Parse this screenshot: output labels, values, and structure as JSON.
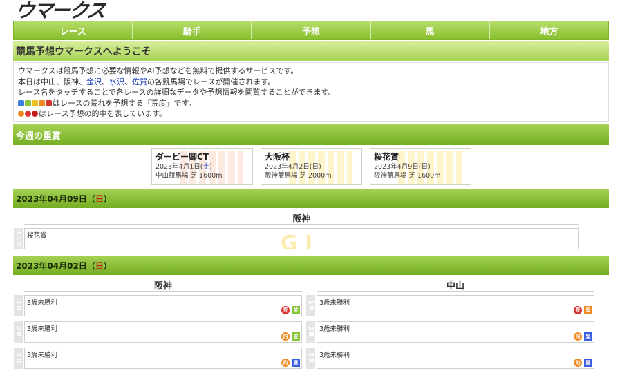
{
  "logo": "ウマークス",
  "nav": [
    "レース",
    "騎手",
    "予想",
    "馬",
    "地方"
  ],
  "welcome": {
    "title": "競馬予想ウマークスへようこそ",
    "line1": "ウマークスは競馬予想に必要な情報やAI予想などを無料で提供するサービスです。",
    "line2_pre": "本日は中山、阪神、",
    "line2_links": [
      "金沢",
      "水沢",
      "佐賀"
    ],
    "line2_sep": "、",
    "line2_post": "の各競馬場でレースが開催されます。",
    "line3": "レース名をタッチすることで各レースの詳細なデータや予想情報を閲覧することができます。",
    "line4": "はレースの荒れを予想する「荒度」です。",
    "line5": "はレース予想の的中を表しています。"
  },
  "colors": {
    "accent": "#86bf2d",
    "arado": [
      "#3b7de0",
      "#86c43a",
      "#f0c020",
      "#f08a20",
      "#d8322e"
    ],
    "hit": [
      "#f08a20",
      "#d8322e",
      "#c41c1c"
    ]
  },
  "graded": {
    "title": "今週の重賞",
    "cards": [
      {
        "name": "ダービー卿CT",
        "date_pre": "2023年4月1日(",
        "day": "土",
        "date_post": ")",
        "course": "中山競馬場 芝 1600m"
      },
      {
        "name": "大阪杯",
        "date_pre": "2023年4月2日(",
        "day": "日",
        "date_post": ")",
        "course": "阪神競馬場 芝 2000m"
      },
      {
        "name": "桜花賞",
        "date_pre": "2023年4月9日(",
        "day": "日",
        "date_post": ")",
        "course": "阪神競馬場 芝 1600m"
      }
    ]
  },
  "day1": {
    "date": "2023年04月09日（",
    "dow": "日",
    "close": "）",
    "venue": "阪神",
    "race": {
      "num": "11R",
      "name": "桜花賞",
      "grade": "G I"
    }
  },
  "day2": {
    "date": "2023年04月02日（",
    "dow": "日",
    "close": "）",
    "left": {
      "venue": "阪神",
      "races": [
        {
          "num": "1R",
          "name": "3歳未勝利",
          "b1": "荒",
          "b2": "並"
        },
        {
          "num": "2R",
          "name": "3歳未勝利",
          "b1": "的",
          "b2": "並"
        },
        {
          "num": "3R",
          "name": "3歳未勝利",
          "b1": "的",
          "b2": "堅"
        }
      ]
    },
    "right": {
      "venue": "中山",
      "races": [
        {
          "num": "1R",
          "name": "3歳未勝利",
          "b1": "荒",
          "b2": "堅"
        },
        {
          "num": "2R",
          "name": "3歳未勝利",
          "b1": "的",
          "b2": "堅"
        },
        {
          "num": "3R",
          "name": "3歳未勝利",
          "b1": "的",
          "b2": "堅"
        }
      ]
    }
  }
}
